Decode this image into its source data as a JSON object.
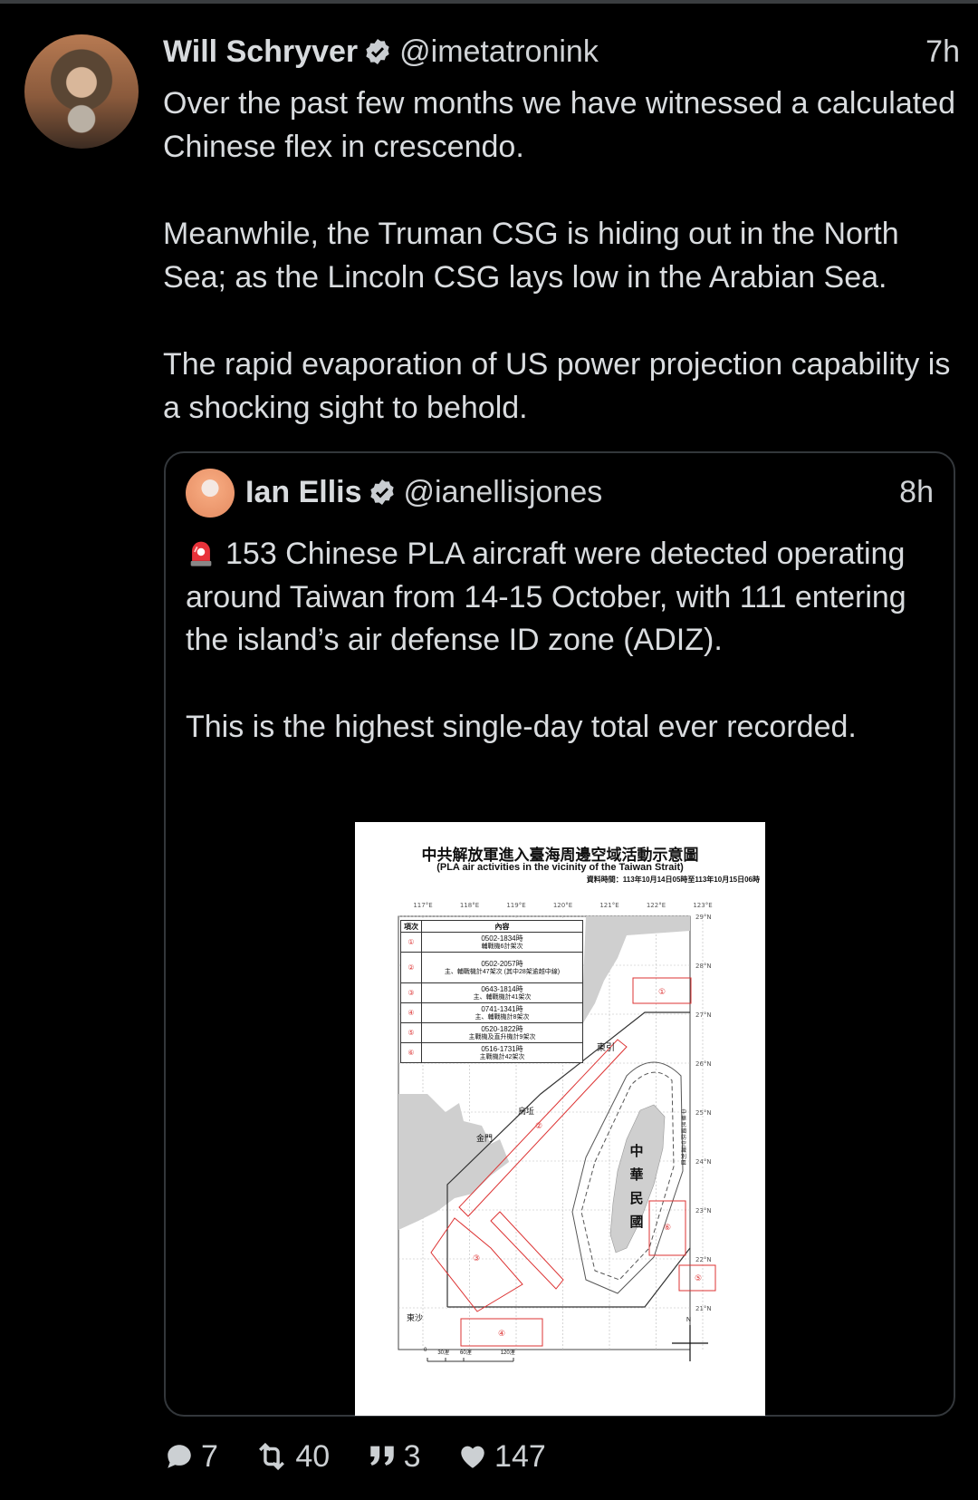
{
  "tweet": {
    "author_name": "Will Schryver",
    "author_handle": "@imetatronink",
    "time": "7h",
    "paragraphs": [
      "Over the past few months we have witnessed a calculated Chinese flex in crescendo.",
      "Meanwhile, the Truman CSG is hiding out in the North Sea; as the Lincoln CSG lays low in the Arabian Sea.",
      "The rapid evaporation of US power projection capability is a shocking sight to behold."
    ]
  },
  "quote": {
    "author_name": "Ian Ellis",
    "author_handle": "@ianellisjones",
    "time": "8h",
    "paragraphs": [
      "153 Chinese PLA aircraft were detected operating around Taiwan from 14-15 October, with 111 entering the island’s air defense ID zone (ADIZ).",
      "This is the highest single-day total ever recorded."
    ],
    "map": {
      "title": "中共解放軍進入臺海周邊空域活動示意圖",
      "subtitle": "(PLA air activities in the vicinity of the Taiwan Strait)",
      "date": "資料時間：113年10月14日05時至113年10月15日06時",
      "longitudes": [
        "117°E",
        "118°E",
        "119°E",
        "120°E",
        "121°E",
        "122°E",
        "123°E"
      ],
      "latitudes": [
        "29°N",
        "28°N",
        "27°N",
        "26°N",
        "25°N",
        "24°N",
        "23°N",
        "22°N",
        "21°N"
      ],
      "table_headers": [
        "項次",
        "內容"
      ],
      "rows": [
        {
          "num": "①",
          "time": "0502-1834時",
          "desc": "輔戰機6計架次"
        },
        {
          "num": "②",
          "time": "0502-2057時",
          "desc": "主、輔戰機計47架次 (其中28架逾越中線)"
        },
        {
          "num": "③",
          "time": "0643-1814時",
          "desc": "主、輔戰機計41架次"
        },
        {
          "num": "④",
          "time": "0741-1341時",
          "desc": "主、輔戰機計8架次"
        },
        {
          "num": "⑤",
          "time": "0520-1822時",
          "desc": "主戰機及直升機計9架次"
        },
        {
          "num": "⑥",
          "time": "0516-1731時",
          "desc": "主戰機計42架次"
        }
      ],
      "place_labels": {
        "dongyin": "東引",
        "wuqiu": "烏坵",
        "kinmen": "金門",
        "roc": "中華民國",
        "dongsha": "東沙",
        "adiz_label": "中華民國防空識別區"
      },
      "scale": [
        "0",
        "30浬",
        "60浬",
        "120浬"
      ],
      "north": "N"
    }
  },
  "actions": {
    "replies": "7",
    "retweets": "40",
    "quotes": "3",
    "likes": "147"
  }
}
